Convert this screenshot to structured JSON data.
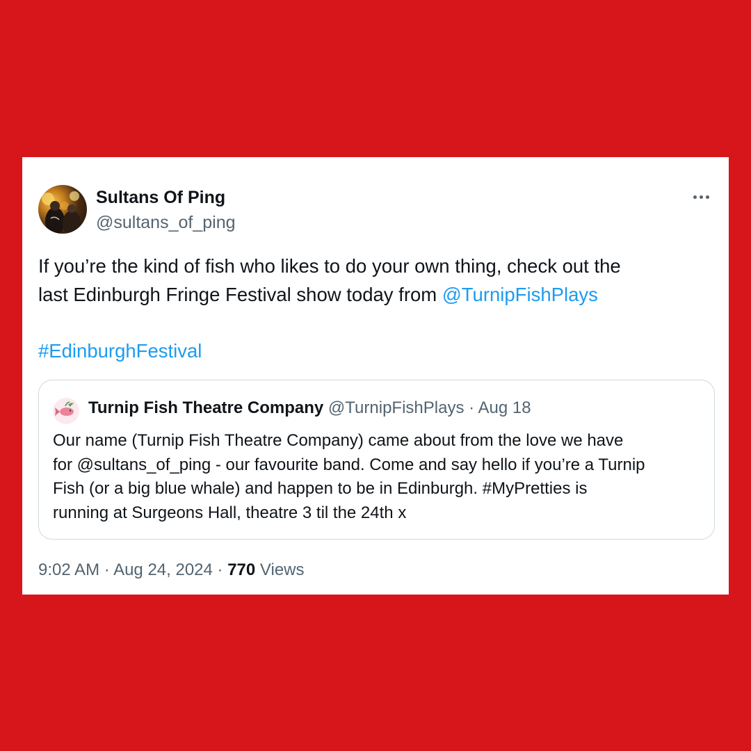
{
  "tweet": {
    "display_name": "Sultans Of Ping",
    "handle": "@sultans_of_ping",
    "more_icon": "more-horizontal-icon",
    "text_line1": "If you’re the kind of fish who likes to do your own thing, check out the",
    "text_line2_pre": "last Edinburgh Fringe Festival show today from ",
    "text_line2_mention": "@TurnipFishPlays",
    "hashtag": "#EdinburghFestival",
    "time": "9:02 AM",
    "sep": " · ",
    "date": "Aug 24, 2024",
    "views_count": "770",
    "views_label": "Views"
  },
  "quote": {
    "name": "Turnip Fish Theatre Company",
    "handle": "@TurnipFishPlays",
    "sep": " · ",
    "date": "Aug 18",
    "lines": [
      "Our name (Turnip Fish Theatre Company) came about from the love we have",
      "for @sultans_of_ping - our favourite band. Come and say hello if you’re a Turnip",
      "Fish (or a big blue whale) and happen to be in Edinburgh. #MyPretties is",
      "running at Surgeons Hall, theatre 3 til the 24th x"
    ]
  },
  "colors": {
    "background": "#d7161c",
    "link": "#1d9bf0",
    "text": "#0f1419",
    "secondary": "#536471",
    "border": "#cfd9de"
  }
}
